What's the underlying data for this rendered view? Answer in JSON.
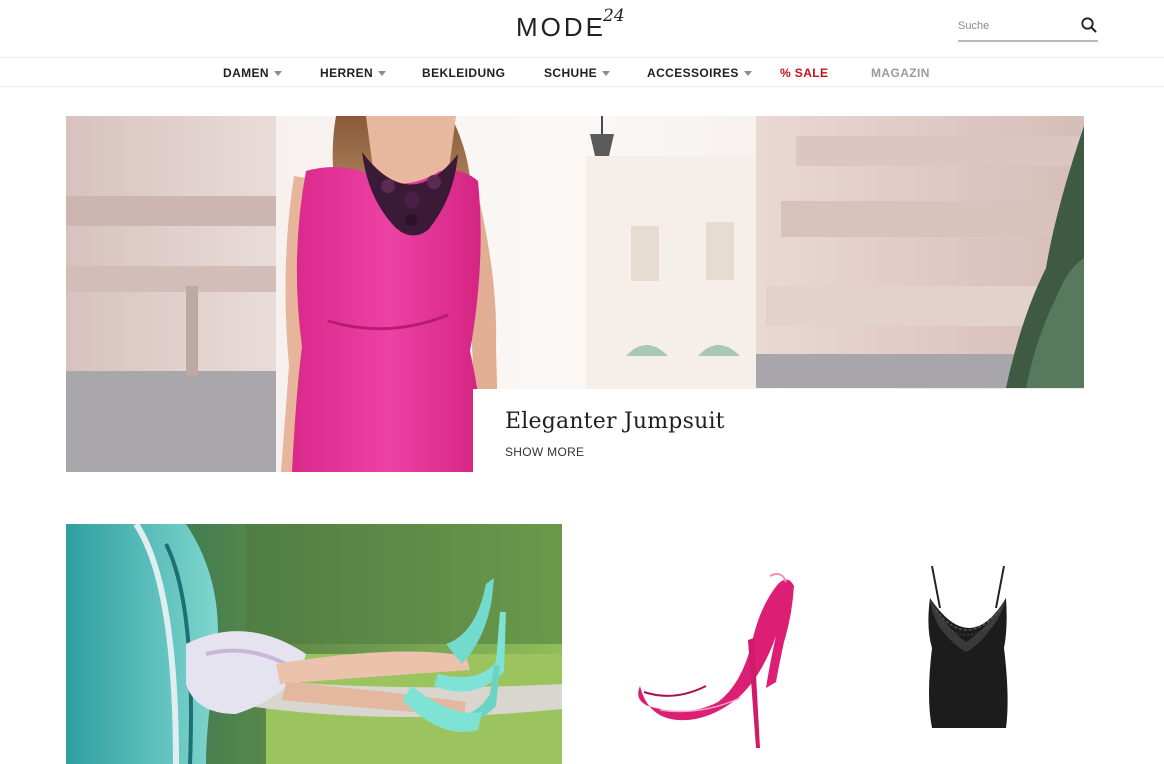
{
  "header": {
    "logo_text": "MODE",
    "logo_superscript": "24",
    "search_placeholder": "Suche"
  },
  "nav": {
    "items": [
      {
        "label": "DAMEN",
        "has_dropdown": true
      },
      {
        "label": "HERREN",
        "has_dropdown": true
      },
      {
        "label": "BEKLEIDUNG",
        "has_dropdown": false
      },
      {
        "label": "SCHUHE",
        "has_dropdown": true
      },
      {
        "label": "ACCESSOIRES",
        "has_dropdown": true
      },
      {
        "label": "% SALE",
        "has_dropdown": false,
        "color": "#c4121a"
      },
      {
        "label": "MAGAZIN",
        "has_dropdown": false,
        "color": "#9b9b9b"
      }
    ]
  },
  "hero": {
    "title": "Eleganter Jumpsuit",
    "link_label": "SHOW MORE"
  },
  "colors": {
    "accent_sale": "#c4121a",
    "jumpsuit_pink": "#e8399c",
    "pump_pink": "#dc1e74",
    "turquoise": "#6fd8c8"
  }
}
